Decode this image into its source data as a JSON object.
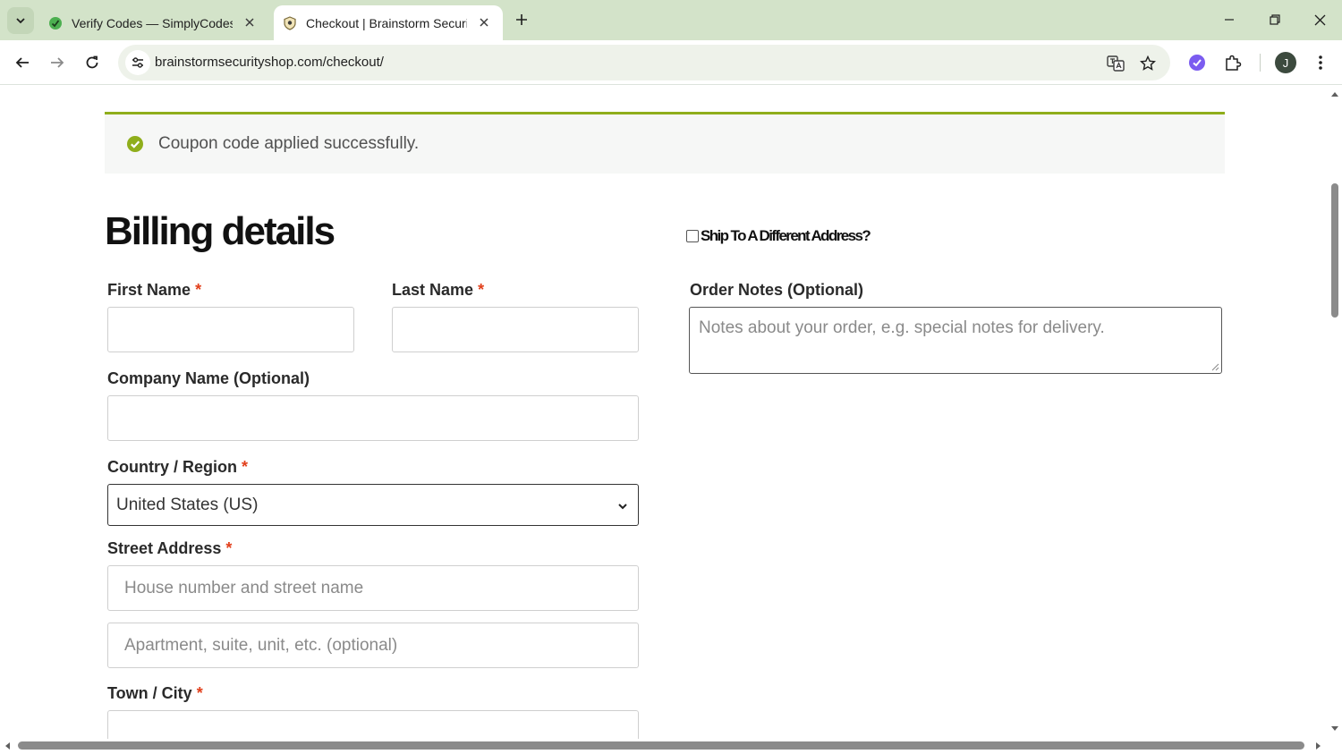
{
  "browser": {
    "tabs": [
      {
        "title": "Verify Codes — SimplyCodes",
        "active": false
      },
      {
        "title": "Checkout | Brainstorm Security Shop",
        "active": true
      }
    ],
    "url": "brainstormsecurityshop.com/checkout/",
    "profile_initial": "J",
    "accent_color": "#d3e3c9"
  },
  "notice": {
    "message": "Coupon code applied successfully.",
    "icon": "check-circle-icon",
    "color": "#8fae1b"
  },
  "billing": {
    "title": "Billing details",
    "required_marker": "*",
    "first_name_label": "First Name",
    "last_name_label": "Last Name",
    "company_label": "Company Name (Optional)",
    "country_label": "Country / Region",
    "country_value": "United States (US)",
    "street_label": "Street Address",
    "street_placeholder": "House number and street name",
    "street2_placeholder": "Apartment, suite, unit, etc. (optional)",
    "city_label": "Town / City"
  },
  "shipping": {
    "ship_different_label": "Ship To A Different Address?",
    "order_notes_label": "Order Notes (Optional)",
    "order_notes_placeholder": "Notes about your order, e.g. special notes for delivery."
  }
}
